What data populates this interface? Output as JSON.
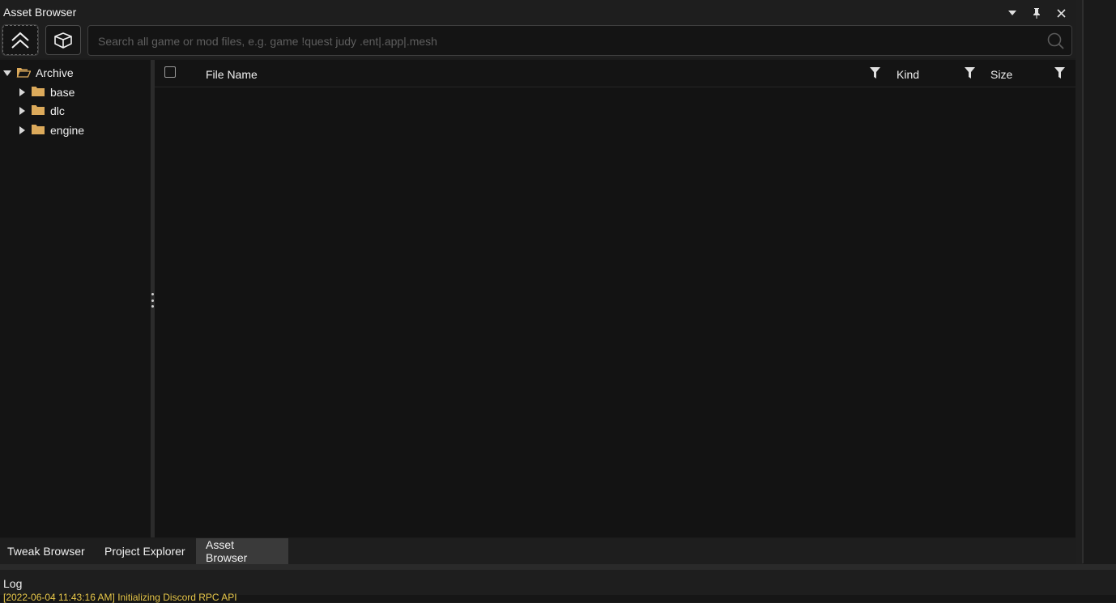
{
  "window": {
    "title": "Asset Browser"
  },
  "search": {
    "placeholder": "Search all game or mod files, e.g. game !quest judy .ent|.app|.mesh",
    "value": ""
  },
  "tree": {
    "root": {
      "label": "Archive",
      "expanded": true
    },
    "children": [
      {
        "label": "base",
        "expanded": false
      },
      {
        "label": "dlc",
        "expanded": false
      },
      {
        "label": "engine",
        "expanded": false
      }
    ]
  },
  "file_list": {
    "columns": {
      "name": "File Name",
      "kind": "Kind",
      "size": "Size"
    },
    "rows": []
  },
  "tabs": [
    {
      "label": "Tweak Browser",
      "active": false
    },
    {
      "label": "Project Explorer",
      "active": false
    },
    {
      "label": "Asset Browser",
      "active": true
    }
  ],
  "log": {
    "title": "Log",
    "last_line": "[2022-06-04 11:43:16 AM] Initializing Discord RPC API"
  },
  "colors": {
    "folder": "#dcaa5b",
    "background": "#131313",
    "log_text": "#e8c84a"
  }
}
